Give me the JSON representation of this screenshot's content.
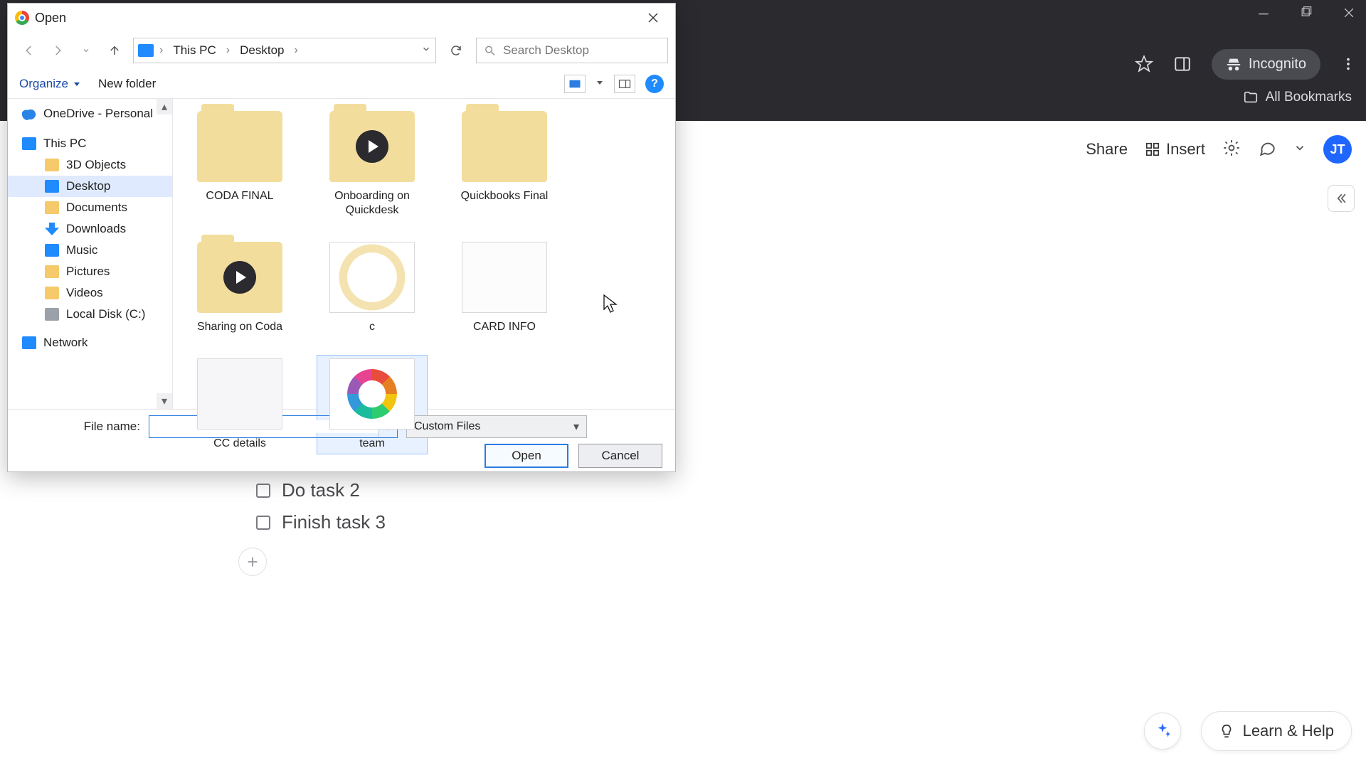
{
  "chrome": {
    "incognito_label": "Incognito",
    "all_bookmarks": "All Bookmarks"
  },
  "app": {
    "share": "Share",
    "insert": "Insert",
    "avatar_initials": "JT",
    "learn_help": "Learn & Help"
  },
  "doc": {
    "tasks": [
      "Do task 2",
      "Finish task 3"
    ]
  },
  "dialog": {
    "title": "Open",
    "breadcrumb": {
      "pc": "This PC",
      "desktop": "Desktop"
    },
    "search_placeholder": "Search Desktop",
    "organize": "Organize",
    "new_folder": "New folder",
    "tree": {
      "onedrive": "OneDrive - Personal",
      "this_pc": "This PC",
      "objects3d": "3D Objects",
      "desktop": "Desktop",
      "documents": "Documents",
      "downloads": "Downloads",
      "music": "Music",
      "pictures": "Pictures",
      "videos": "Videos",
      "localdisk": "Local Disk (C:)",
      "network": "Network"
    },
    "files": [
      {
        "name": "CODA FINAL"
      },
      {
        "name": "Onboarding on Quickdesk"
      },
      {
        "name": "Quickbooks Final"
      },
      {
        "name": "Sharing on Coda"
      },
      {
        "name": "c"
      },
      {
        "name": "CARD INFO"
      },
      {
        "name": "CC details"
      },
      {
        "name": "team"
      }
    ],
    "file_name_label": "File name:",
    "file_name_value": "",
    "file_type": "Custom Files",
    "open_btn": "Open",
    "cancel_btn": "Cancel",
    "help_glyph": "?"
  }
}
